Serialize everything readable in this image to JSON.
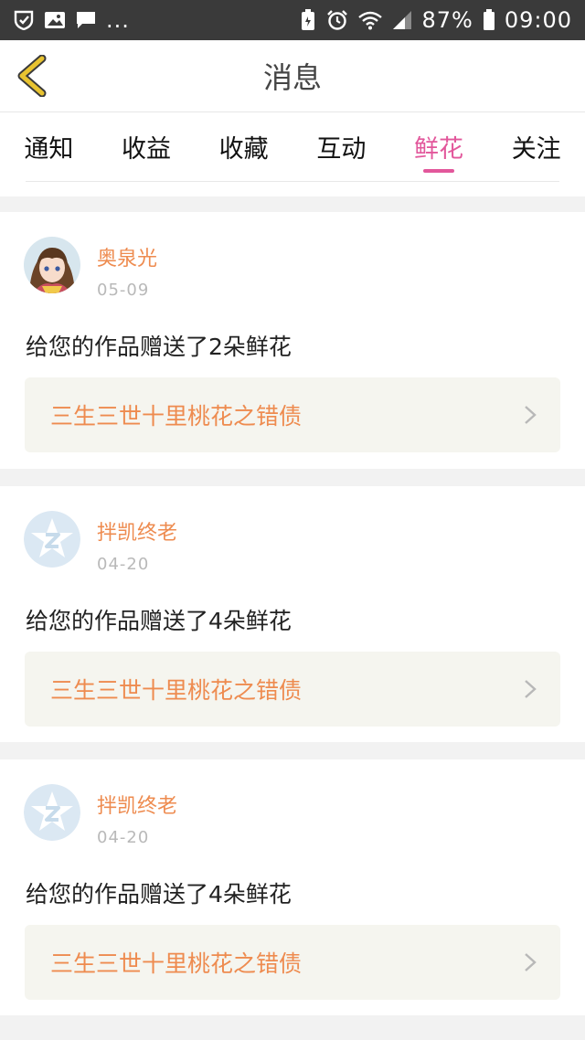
{
  "status_bar": {
    "left_icons": [
      "shield-icon",
      "image-icon",
      "chat-icon"
    ],
    "left_more": "...",
    "battery": "87%",
    "time": "09:00"
  },
  "nav": {
    "title": "消息"
  },
  "tabs": [
    {
      "label": "通知",
      "active": false
    },
    {
      "label": "收益",
      "active": false
    },
    {
      "label": "收藏",
      "active": false
    },
    {
      "label": "互动",
      "active": false
    },
    {
      "label": "鲜花",
      "active": true
    },
    {
      "label": "关注",
      "active": false
    }
  ],
  "messages": [
    {
      "user": "奥泉光",
      "date": "05-09",
      "text": "给您的作品赠送了2朵鲜花",
      "work": "三生三世十里桃花之错债",
      "avatar": "anime-avatar"
    },
    {
      "user": "拌凯终老",
      "date": "04-20",
      "text": "给您的作品赠送了4朵鲜花",
      "work": "三生三世十里桃花之错债",
      "avatar": "default-avatar"
    },
    {
      "user": "拌凯终老",
      "date": "04-20",
      "text": "给您的作品赠送了4朵鲜花",
      "work": "三生三世十里桃花之错债",
      "avatar": "default-avatar"
    }
  ],
  "colors": {
    "accent": "#e2579b",
    "username": "#ee8b4f",
    "back_arrow": "#e8c330"
  }
}
